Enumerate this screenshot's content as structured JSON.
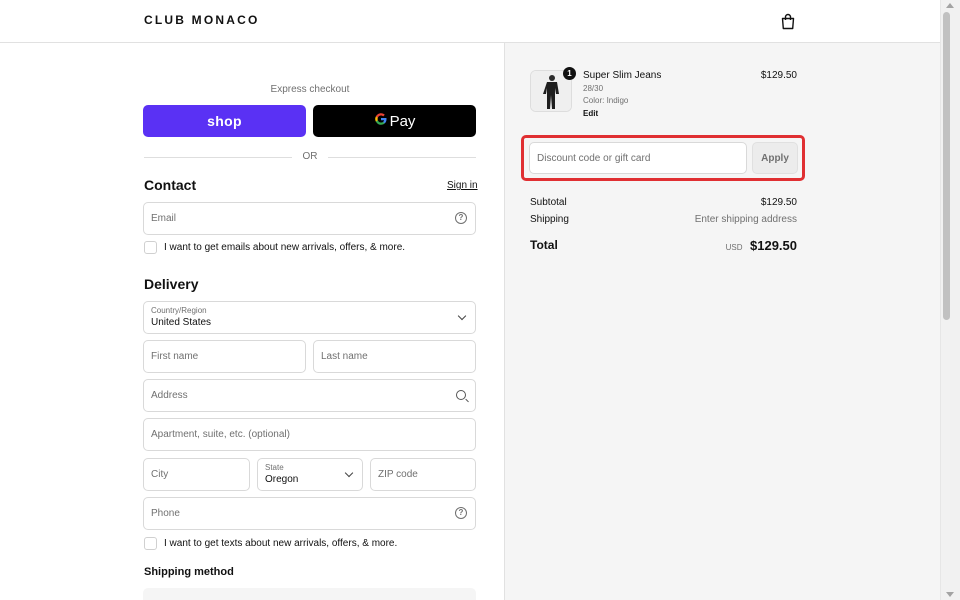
{
  "header": {
    "brand": "CLUB MONACO",
    "cart_icon": "shopping-bag-icon"
  },
  "express": {
    "label": "Express checkout",
    "shop_label": "shop",
    "gpay_g": "G",
    "gpay_label": "Pay",
    "or_label": "OR"
  },
  "contact": {
    "title": "Contact",
    "signin_label": "Sign in",
    "email_placeholder": "Email",
    "newsletter_label": "I want to get emails about new arrivals, offers, & more."
  },
  "delivery": {
    "title": "Delivery",
    "country_label": "Country/Region",
    "country_value": "United States",
    "first_name_placeholder": "First name",
    "last_name_placeholder": "Last name",
    "address_placeholder": "Address",
    "apartment_placeholder": "Apartment, suite, etc. (optional)",
    "city_placeholder": "City",
    "state_label": "State",
    "state_value": "Oregon",
    "zip_placeholder": "ZIP code",
    "phone_placeholder": "Phone",
    "sms_label": "I want to get texts about new arrivals, offers, & more.",
    "shipping_method_title": "Shipping method"
  },
  "order": {
    "quantity": "1",
    "product_name": "Super Slim Jeans",
    "size": "28/30",
    "color": "Color: Indigo",
    "edit_label": "Edit",
    "price": "$129.50",
    "discount_placeholder": "Discount code or gift card",
    "apply_label": "Apply",
    "subtotal_label": "Subtotal",
    "subtotal_value": "$129.50",
    "shipping_label": "Shipping",
    "shipping_value": "Enter shipping address",
    "total_label": "Total",
    "currency": "USD",
    "total_value": "$129.50"
  },
  "colors": {
    "shop_purple": "#5a31f4",
    "highlight_red": "#e02f32",
    "panel_bg": "#f5f5f5"
  }
}
